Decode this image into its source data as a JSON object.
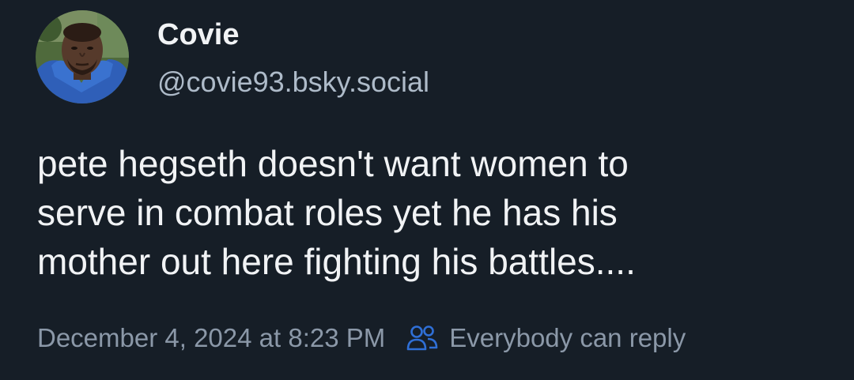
{
  "author": {
    "display_name": "Covie",
    "handle": "@covie93.bsky.social",
    "avatar_icon": "user-avatar-photo"
  },
  "post": {
    "text_lines": [
      "pete hegseth doesn't want women to",
      "serve in combat roles yet he has his",
      "mother out here fighting his battles...."
    ]
  },
  "footer": {
    "timestamp": "December 4, 2024 at 8:23 PM",
    "reply_setting": "Everybody can reply",
    "reply_icon": "people-icon"
  },
  "colors": {
    "background": "#161e27",
    "text_primary": "#f1f3f5",
    "text_secondary": "#aebbc9",
    "text_muted": "#8b98a8",
    "reply_icon": "#2f6fd6"
  }
}
